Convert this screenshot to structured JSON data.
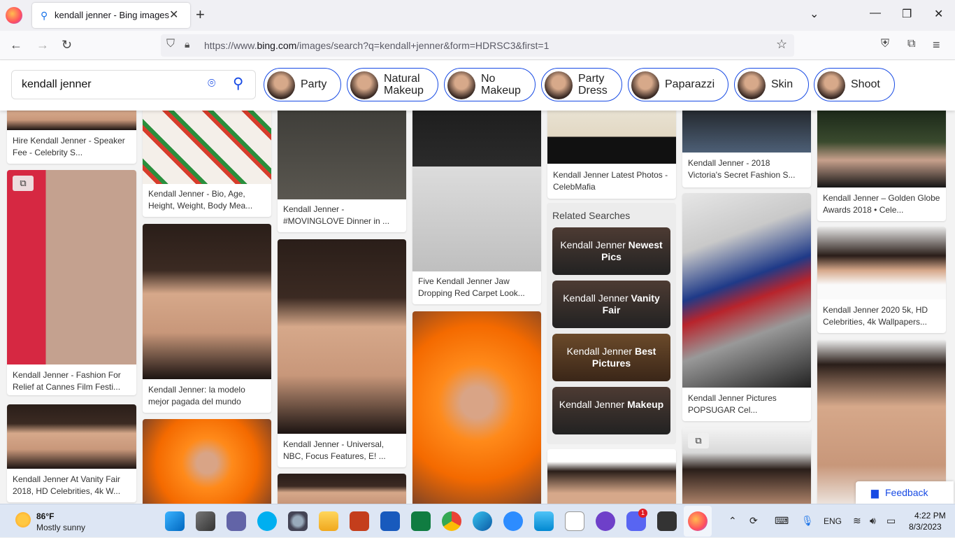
{
  "browser": {
    "tab_title": "kendall jenner - Bing images",
    "url_prefix": "https://www.",
    "url_domain": "bing.com",
    "url_rest": "/images/search?q=kendall+jenner&form=HDRSC3&first=1"
  },
  "search": {
    "query": "kendall jenner"
  },
  "chips": [
    {
      "label": "Party"
    },
    {
      "label": "Natural\nMakeup"
    },
    {
      "label": "No\nMakeup"
    },
    {
      "label": "Party\nDress"
    },
    {
      "label": "Paparazzi"
    },
    {
      "label": "Skin"
    },
    {
      "label": "Shoot"
    }
  ],
  "results": {
    "c1": [
      "Hire Kendall Jenner - Speaker Fee - Celebrity S...",
      "Kendall Jenner - Fashion For Relief at Cannes Film Festi...",
      "Kendall Jenner At Vanity Fair 2018, HD Celebrities, 4k W..."
    ],
    "c2": [
      "Kendall Jenner - Bio, Age, Height, Weight, Body Mea...",
      "Kendall Jenner: la modelo mejor pagada del mundo"
    ],
    "c3": [
      "Kendall Jenner - #MOVINGLOVE Dinner in ...",
      "Kendall Jenner - Universal, NBC, Focus Features, E! ..."
    ],
    "c4": [
      "Five Kendall Jenner Jaw Dropping Red Carpet Look..."
    ],
    "c5": [
      "Kendall Jenner Latest Photos - CelebMafia"
    ],
    "c6": [
      "Kendall Jenner - 2018 Victoria's Secret Fashion S...",
      "Kendall Jenner Pictures POPSUGAR Cel..."
    ],
    "c7": [
      "Kendall Jenner – Golden Globe Awards 2018 • Cele...",
      "Kendall Jenner 2020 5k, HD Celebrities, 4k Wallpapers..."
    ]
  },
  "related": {
    "title": "Related Searches",
    "items": [
      {
        "pre": "Kendall Jenner ",
        "bold": "Newest Pics"
      },
      {
        "pre": "Kendall Jenner ",
        "bold": "Vanity Fair"
      },
      {
        "pre": "Kendall Jenner ",
        "bold": "Best Pictures"
      },
      {
        "pre": "Kendall Jenner ",
        "bold": "Makeup"
      }
    ]
  },
  "feedback": "Feedback",
  "taskbar": {
    "temp": "86°F",
    "condition": "Mostly sunny",
    "lang": "ENG",
    "time": "4:22 PM",
    "date": "8/3/2023",
    "discord_badge": "1"
  }
}
